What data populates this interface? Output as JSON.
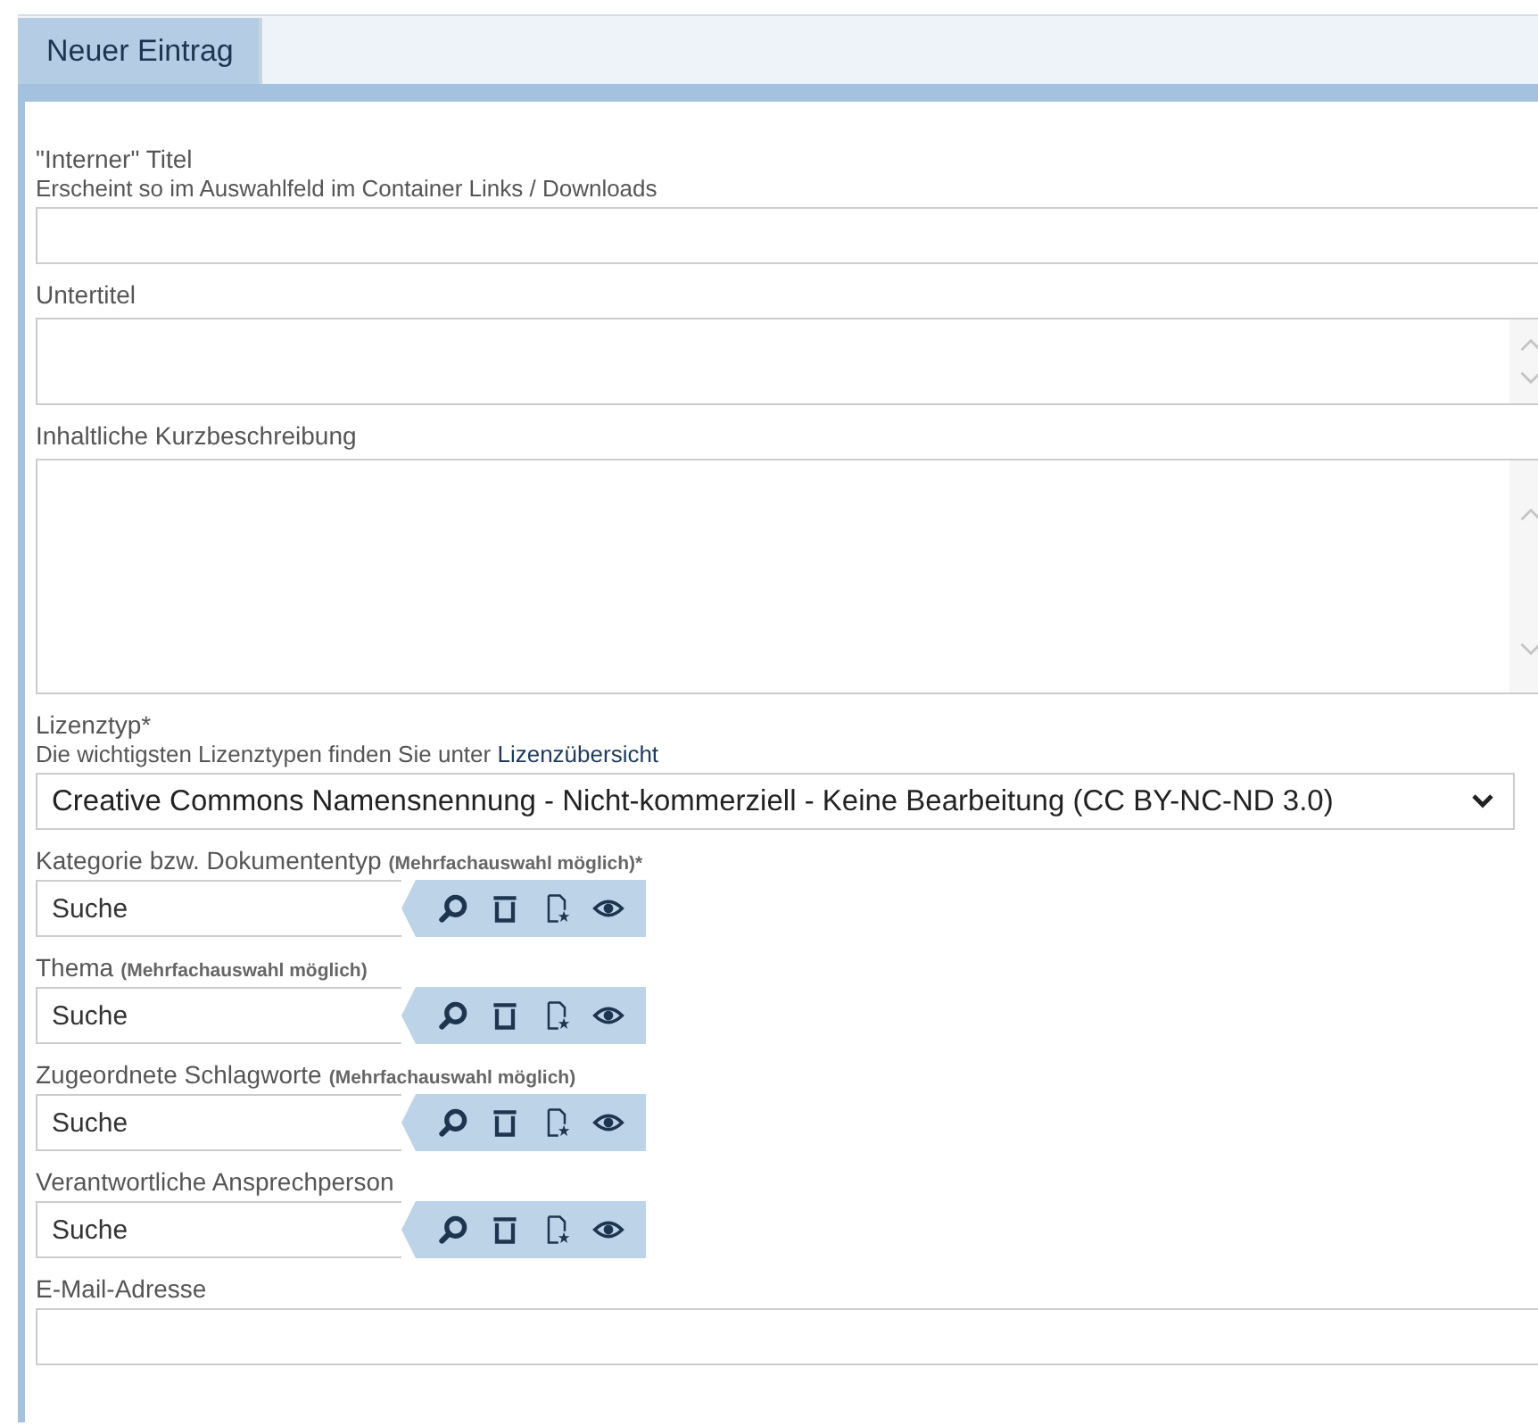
{
  "tabs": [
    {
      "label": "Neuer Eintrag",
      "selected": true
    }
  ],
  "fields": [
    {
      "kind": "text",
      "label": "\"Interner\" Titel",
      "description": "Erscheint so im Auswahlfeld im Container Links / Downloads"
    },
    {
      "kind": "textarea",
      "label": "Untertitel"
    },
    {
      "kind": "longtext",
      "label": "Inhaltliche Kurzbeschreibung"
    },
    {
      "kind": "select",
      "label": "Lizenztyp*",
      "description": "Die wichtigsten Lizenztypen finden Sie unter ",
      "link": "Lizenzübersicht",
      "value": "Creative Commons Namensnennung - Nicht-kommerziell - Keine Bearbeitung (CC BY-NC-ND 3.0)"
    },
    {
      "kind": "search",
      "label": "Kategorie bzw. Dokumententyp",
      "note": "(Mehrfachauswahl möglich)*",
      "placeholder": "Suche"
    },
    {
      "kind": "search",
      "label": "Thema",
      "note": "(Mehrfachauswahl möglich)",
      "placeholder": "Suche"
    },
    {
      "kind": "search",
      "label": "Zugeordnete Schlagworte",
      "note": "(Mehrfachauswahl möglich)",
      "placeholder": "Suche"
    },
    {
      "kind": "search",
      "label": "Verantwortliche Ansprechperson",
      "placeholder": "Suche"
    },
    {
      "kind": "text",
      "label": "E-Mail-Adresse"
    }
  ]
}
